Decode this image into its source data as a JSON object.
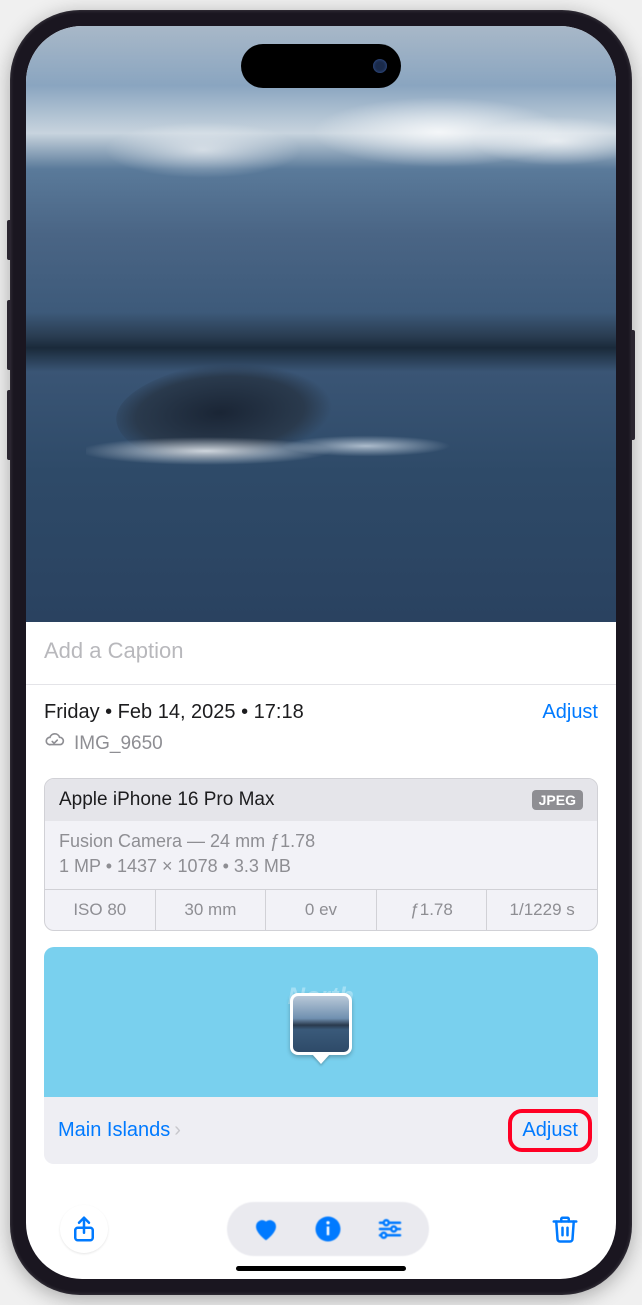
{
  "caption_placeholder": "Add a Caption",
  "meta": {
    "date_line": "Friday • Feb 14, 2025 • 17:18",
    "adjust_label": "Adjust",
    "filename": "IMG_9650"
  },
  "camera": {
    "device": "Apple iPhone 16 Pro Max",
    "format_badge": "JPEG",
    "lens_line": "Fusion Camera — 24 mm ƒ1.78",
    "stats_line": "1 MP • 1437 × 1078 • 3.3 MB",
    "exif": {
      "iso": "ISO 80",
      "focal": "30 mm",
      "ev": "0 ev",
      "aperture": "ƒ1.78",
      "shutter": "1/1229 s"
    }
  },
  "map": {
    "ocean_label": "North\nPac\nOce",
    "location": "Main Islands",
    "adjust_label": "Adjust"
  },
  "colors": {
    "accent": "#007aff",
    "highlight_border": "#ff0024"
  }
}
